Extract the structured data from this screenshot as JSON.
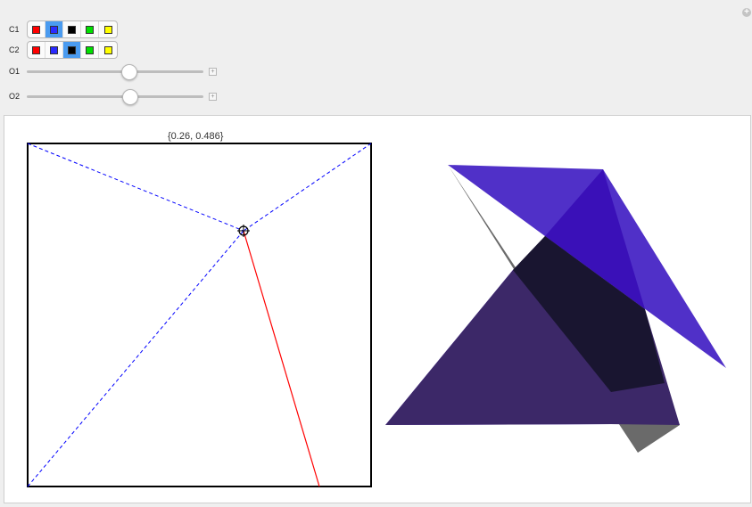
{
  "controls": {
    "c1": {
      "label": "C1",
      "options": [
        {
          "name": "red",
          "color": "#ff0000"
        },
        {
          "name": "blue",
          "color": "#2a2aff"
        },
        {
          "name": "black",
          "color": "#000000"
        },
        {
          "name": "green",
          "color": "#00e000"
        },
        {
          "name": "yellow",
          "color": "#ffff00"
        }
      ],
      "selected": "blue"
    },
    "c2": {
      "label": "C2",
      "options": [
        {
          "name": "red",
          "color": "#ff0000"
        },
        {
          "name": "blue",
          "color": "#2a2aff"
        },
        {
          "name": "black",
          "color": "#000000"
        },
        {
          "name": "green",
          "color": "#00e000"
        },
        {
          "name": "yellow",
          "color": "#ffff00"
        }
      ],
      "selected": "black"
    },
    "o1": {
      "label": "O1",
      "fraction": 0.58
    },
    "o2": {
      "label": "O2",
      "fraction": 0.59
    }
  },
  "locator": {
    "label": "{0.26, 0.486}"
  },
  "colors": {
    "dashed_line": "#0000ff",
    "red_line": "#ff0000",
    "blue_fill": "#3a10c8",
    "light_purple": "#8a66ff",
    "gray_fill": "#6a6a6a",
    "dark_purple": "#3c2868"
  },
  "icons": {
    "corner": "plus-circle-icon",
    "slider_step": "plus-box-icon",
    "locator": "crosshair-icon"
  }
}
